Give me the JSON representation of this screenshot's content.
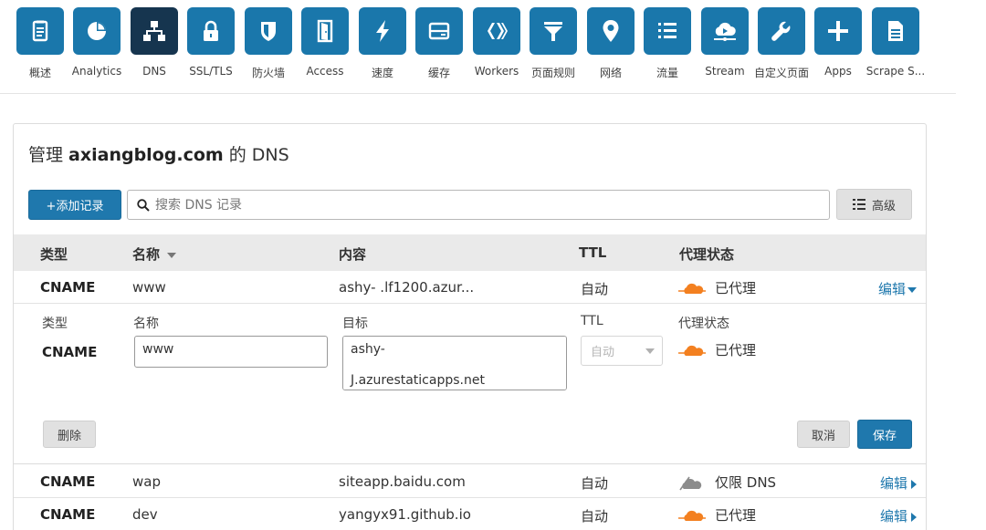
{
  "nav": {
    "items": [
      {
        "label": "概述",
        "icon": "overview-icon"
      },
      {
        "label": "Analytics",
        "icon": "analytics-icon"
      },
      {
        "label": "DNS",
        "icon": "dns-icon",
        "active": true
      },
      {
        "label": "SSL/TLS",
        "icon": "lock-icon"
      },
      {
        "label": "防火墙",
        "icon": "shield-icon"
      },
      {
        "label": "Access",
        "icon": "door-icon"
      },
      {
        "label": "速度",
        "icon": "lightning-icon"
      },
      {
        "label": "缓存",
        "icon": "cache-icon"
      },
      {
        "label": "Workers",
        "icon": "workers-icon"
      },
      {
        "label": "页面规则",
        "icon": "filter-icon"
      },
      {
        "label": "网络",
        "icon": "location-pin-icon"
      },
      {
        "label": "流量",
        "icon": "list-icon"
      },
      {
        "label": "Stream",
        "icon": "cloud-stream-icon"
      },
      {
        "label": "自定义页面",
        "icon": "wrench-icon"
      },
      {
        "label": "Apps",
        "icon": "plus-icon"
      },
      {
        "label": "Scrape S...",
        "icon": "document-icon"
      }
    ]
  },
  "card": {
    "title_prefix": "管理 ",
    "domain": "axiangblog.com",
    "title_suffix": " 的 DNS"
  },
  "toolbar": {
    "add_record": "+添加记录",
    "search_placeholder": "搜索 DNS 记录",
    "advanced": "高级"
  },
  "table": {
    "headers": {
      "type": "类型",
      "name": "名称",
      "content": "内容",
      "ttl": "TTL",
      "proxy": "代理状态"
    },
    "rows": [
      {
        "type": "CNAME",
        "name": "www",
        "content": "ashy-                        .lf1200.azur...",
        "ttl": "自动",
        "proxy": "已代理",
        "proxied": true,
        "edit": "编辑"
      },
      {
        "type": "CNAME",
        "name": "wap",
        "content": "siteapp.baidu.com",
        "ttl": "自动",
        "proxy": "仅限 DNS",
        "proxied": false,
        "edit": "编辑"
      },
      {
        "type": "CNAME",
        "name": "dev",
        "content": "yangyx91.github.io",
        "ttl": "自动",
        "proxy": "已代理",
        "proxied": true,
        "edit": "编辑"
      }
    ]
  },
  "edit_panel": {
    "labels": {
      "type": "类型",
      "name": "名称",
      "target": "目标",
      "ttl": "TTL",
      "proxy": "代理状态"
    },
    "type_value": "CNAME",
    "name_value": "www",
    "target_value": "ashy-                     \n                    J.azurestaticapps.net",
    "ttl_value": "自动",
    "proxy_value": "已代理",
    "delete": "删除",
    "cancel": "取消",
    "save": "保存"
  },
  "colors": {
    "accent": "#1f78ad",
    "nav_tile": "#1a77ab",
    "nav_active": "#16354f",
    "cloud_orange": "#f38020",
    "cloud_grey": "#8c8c8c"
  }
}
